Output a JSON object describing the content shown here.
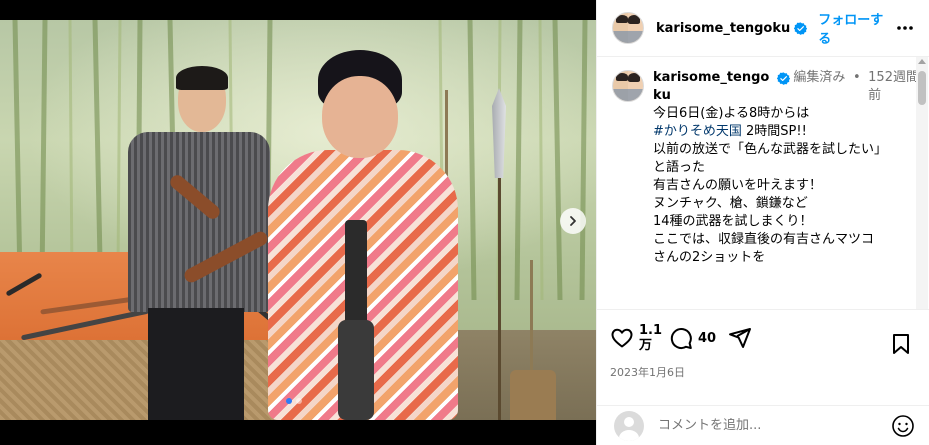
{
  "post": {
    "username": "karisome_tengoku",
    "follow_label": "フォローする",
    "more_icon": "more-horizontal-icon",
    "verified_icon": "verified-badge-icon"
  },
  "caption": {
    "username_line1": "karisome_tengo",
    "username_line2": "ku",
    "edited": "編集済み",
    "separator": "•",
    "age": "152週間",
    "age_line2": "前",
    "lines": [
      "今日6日(金)よる8時からは",
      "",
      "",
      "以前の放送で「色んな武器を試したい」",
      "と語った",
      "有吉さんの願いを叶えます！",
      "",
      "ヌンチャク、槍、鎖鎌など",
      "14種の武器を試しまくり！",
      "",
      "ここでは、収録直後の有吉さんマツコ",
      "さんの2ショットを"
    ],
    "hashtag": "#かりそめ天国",
    "hashtag_suffix": " 2時間SP!!"
  },
  "actions": {
    "like_count_line1": "1.1",
    "like_count_line2": "万",
    "comment_count": "40",
    "date": "2023年1月6日"
  },
  "comment": {
    "placeholder": "コメントを追加..."
  },
  "carousel": {
    "total": 2,
    "active_index": 0
  }
}
